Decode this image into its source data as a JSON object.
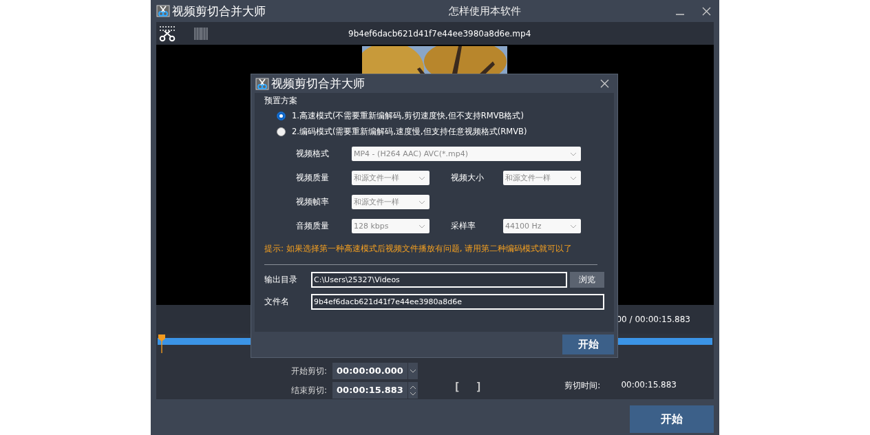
{
  "window": {
    "title": "视频剪切合并大师",
    "help_link": "怎样使用本软件"
  },
  "toolbar": {
    "file_name": "9b4ef6dacb621d41f7e44ee3980a8d6e.mp4"
  },
  "player": {
    "time": "00 / 00:00:15.883"
  },
  "cut": {
    "start_label": "开始剪切:",
    "start_value": "00:00:00.000",
    "end_label": "结束剪切:",
    "end_value": "00:00:15.883",
    "mark_in": "[",
    "mark_out": "]",
    "duration_label": "剪切时间:",
    "duration_value": "00:00:15.883"
  },
  "start_button": "开始",
  "dialog": {
    "title": "视频剪切合并大师",
    "section": "预置方案",
    "modes": [
      {
        "label": "1.高速模式(不需要重新编解码,剪切速度快,但不支持RMVB格式)",
        "selected": true
      },
      {
        "label": "2.编码模式(需要重新编解码,速度慢,但支持任意视频格式(RMVB)",
        "selected": false
      }
    ],
    "settings_rows": [
      [
        {
          "kind": "wide",
          "label": "视频格式",
          "value": "MP4 - (H264 AAC) AVC(*.mp4)"
        }
      ],
      [
        {
          "kind": "normal",
          "label": "视频质量",
          "value": "和源文件一样"
        },
        {
          "kind": "normal",
          "label": "视频大小",
          "value": "和源文件一样"
        }
      ],
      [
        {
          "kind": "normal",
          "label": "视频帧率",
          "value": "和源文件一样"
        }
      ],
      [
        {
          "kind": "normal",
          "label": "音频质量",
          "value": "128 kbps"
        },
        {
          "kind": "normal",
          "label": "采样率",
          "value": "44100 Hz"
        }
      ]
    ],
    "tip": "提示: 如果选择第一种高速模式后视频文件播放有问题, 请用第二种编码模式就可以了",
    "output_label": "输出目录",
    "output_value": "C:\\Users\\25327\\Videos",
    "browse_button": "浏览",
    "filename_label": "文件名",
    "filename_value": "9b4ef6dacb621d41f7e44ee3980a8d6e",
    "start_button": "开始"
  }
}
